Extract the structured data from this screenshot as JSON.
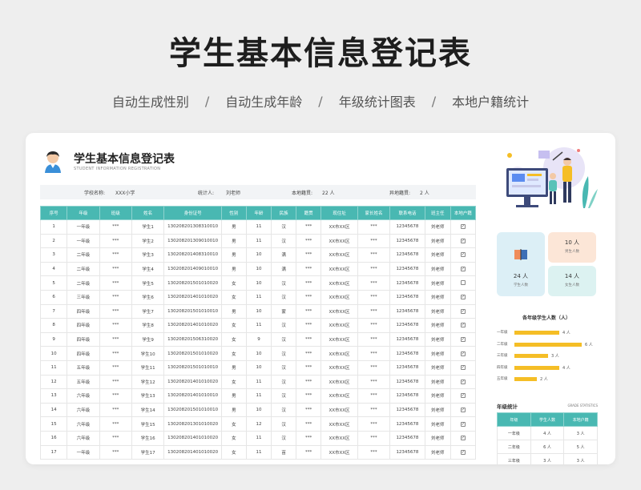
{
  "page_title": "学生基本信息登记表",
  "features": [
    "自动生成性别",
    "自动生成年龄",
    "年级统计图表",
    "本地户籍统计"
  ],
  "separator": "/",
  "sheet": {
    "title": "学生基本信息登记表",
    "subtitle": "STUDENT INFORMATION REGISTRATION"
  },
  "info": {
    "school_label": "学校名称:",
    "school_value": "XXX小学",
    "stat_label": "统计人:",
    "stat_value": "刘老师",
    "local_label": "本地籍贯:",
    "local_value": "22 人",
    "nonlocal_label": "异地籍贯:",
    "nonlocal_value": "2 人"
  },
  "student_table": {
    "headers": [
      "序号",
      "年级",
      "班级",
      "姓名",
      "身份证号",
      "性别",
      "年龄",
      "民族",
      "籍贯",
      "现住址",
      "家长姓名",
      "联系电话",
      "班主任",
      "本地户籍"
    ],
    "rows": [
      [
        "1",
        "一年级",
        "***",
        "学生1",
        "130208201308310010",
        "男",
        "11",
        "汉",
        "***",
        "XX市XX区",
        "***",
        "12345678",
        "刘老师",
        "checked"
      ],
      [
        "2",
        "一年级",
        "***",
        "学生2",
        "130208201309010010",
        "男",
        "11",
        "汉",
        "***",
        "XX市XX区",
        "***",
        "12345678",
        "刘老师",
        "checked"
      ],
      [
        "3",
        "二年级",
        "***",
        "学生3",
        "130208201408310010",
        "男",
        "10",
        "满",
        "***",
        "XX市XX区",
        "***",
        "12345678",
        "刘老师",
        "checked"
      ],
      [
        "4",
        "二年级",
        "***",
        "学生4",
        "130208201409010010",
        "男",
        "10",
        "满",
        "***",
        "XX市XX区",
        "***",
        "12345678",
        "刘老师",
        "checked"
      ],
      [
        "5",
        "二年级",
        "***",
        "学生5",
        "130208201501010020",
        "女",
        "10",
        "汉",
        "***",
        "XX市XX区",
        "***",
        "12345678",
        "刘老师",
        "unchecked"
      ],
      [
        "6",
        "三年级",
        "***",
        "学生6",
        "130208201401010020",
        "女",
        "11",
        "汉",
        "***",
        "XX市XX区",
        "***",
        "12345678",
        "刘老师",
        "checked"
      ],
      [
        "7",
        "四年级",
        "***",
        "学生7",
        "130208201501010010",
        "男",
        "10",
        "蒙",
        "***",
        "XX市XX区",
        "***",
        "12345678",
        "刘老师",
        "checked"
      ],
      [
        "8",
        "四年级",
        "***",
        "学生8",
        "130208201401010020",
        "女",
        "11",
        "汉",
        "***",
        "XX市XX区",
        "***",
        "12345678",
        "刘老师",
        "checked"
      ],
      [
        "9",
        "四年级",
        "***",
        "学生9",
        "130208201506310020",
        "女",
        "9",
        "汉",
        "***",
        "XX市XX区",
        "***",
        "12345678",
        "刘老师",
        "checked"
      ],
      [
        "10",
        "四年级",
        "***",
        "学生10",
        "130208201501010020",
        "女",
        "10",
        "汉",
        "***",
        "XX市XX区",
        "***",
        "12345678",
        "刘老师",
        "checked"
      ],
      [
        "11",
        "五年级",
        "***",
        "学生11",
        "130208201501010010",
        "男",
        "10",
        "汉",
        "***",
        "XX市XX区",
        "***",
        "12345678",
        "刘老师",
        "checked"
      ],
      [
        "12",
        "五年级",
        "***",
        "学生12",
        "130208201401010020",
        "女",
        "11",
        "汉",
        "***",
        "XX市XX区",
        "***",
        "12345678",
        "刘老师",
        "checked"
      ],
      [
        "13",
        "六年级",
        "***",
        "学生13",
        "130208201401010010",
        "男",
        "11",
        "汉",
        "***",
        "XX市XX区",
        "***",
        "12345678",
        "刘老师",
        "checked"
      ],
      [
        "14",
        "六年级",
        "***",
        "学生14",
        "130208201501010010",
        "男",
        "10",
        "汉",
        "***",
        "XX市XX区",
        "***",
        "12345678",
        "刘老师",
        "checked"
      ],
      [
        "15",
        "六年级",
        "***",
        "学生15",
        "130208201301010020",
        "女",
        "12",
        "汉",
        "***",
        "XX市XX区",
        "***",
        "12345678",
        "刘老师",
        "checked"
      ],
      [
        "16",
        "六年级",
        "***",
        "学生16",
        "130208201401010020",
        "女",
        "11",
        "汉",
        "***",
        "XX市XX区",
        "***",
        "12345678",
        "刘老师",
        "checked"
      ],
      [
        "17",
        "一年级",
        "***",
        "学生17",
        "130208201401010020",
        "女",
        "11",
        "苗",
        "***",
        "XX市XX区",
        "***",
        "12345678",
        "刘老师",
        "checked"
      ]
    ]
  },
  "stats": {
    "total_num": "24 人",
    "total_label": "学生人数",
    "male_num": "10 人",
    "male_label": "男生人数",
    "female_num": "14 人",
    "female_label": "女生人数"
  },
  "chart_data": {
    "type": "bar",
    "orientation": "horizontal",
    "title": "各年级学生人数（人）",
    "categories": [
      "一年级",
      "二年级",
      "三年级",
      "四年级",
      "五年级"
    ],
    "values": [
      4,
      6,
      3,
      4,
      2
    ],
    "value_labels": [
      "4 人",
      "6 人",
      "3 人",
      "4 人",
      "2 人"
    ],
    "color": "#f5be26"
  },
  "grade_stats": {
    "title": "年级统计",
    "title_en": "GRADE STATISTICS",
    "headers": [
      "年级",
      "学生人数",
      "本地户籍"
    ],
    "rows": [
      [
        "一年级",
        "4 人",
        "3 人"
      ],
      [
        "二年级",
        "6 人",
        "5 人"
      ],
      [
        "三年级",
        "3 人",
        "3 人"
      ]
    ]
  },
  "colors": {
    "accent": "#49b8b2",
    "bar": "#f5be26"
  }
}
